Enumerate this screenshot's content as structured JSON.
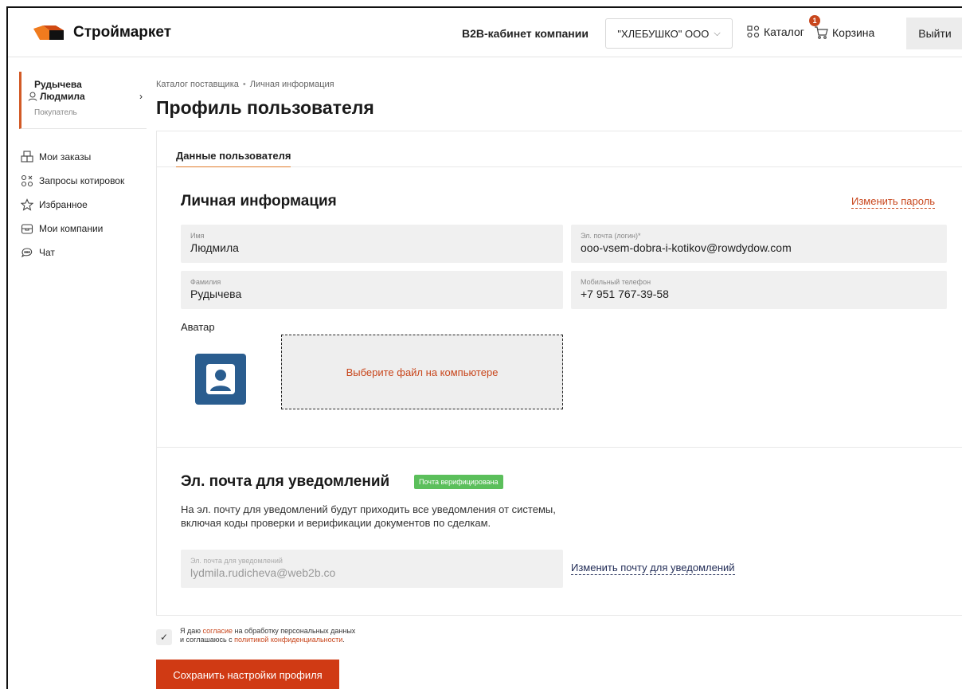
{
  "header": {
    "logo_text": "Строймаркет",
    "b2b_label": "B2B-кабинет компании",
    "company_select": "\"ХЛЕБУШКО\" ООО",
    "catalog_label": "Каталог",
    "cart_label": "Корзина",
    "cart_count": "1",
    "logout_label": "Выйти"
  },
  "sidebar": {
    "user_first_name_line": "Рудычева",
    "user_second_line": "Людмила",
    "user_role": "Покупатель",
    "items": [
      {
        "label": "Мои заказы",
        "icon": "boxes-icon"
      },
      {
        "label": "Запросы котировок",
        "icon": "quotes-icon"
      },
      {
        "label": "Избранное",
        "icon": "star-icon"
      },
      {
        "label": "Мои компании",
        "icon": "company-icon"
      },
      {
        "label": "Чат",
        "icon": "chat-icon"
      }
    ]
  },
  "breadcrumb": {
    "parent": "Каталог поставщика",
    "separator": "•",
    "current": "Личная информация"
  },
  "page_title": "Профиль пользователя",
  "tab_label": "Данные пользователя",
  "personal": {
    "title": "Личная информация",
    "change_password": "Изменить пароль",
    "first_name": {
      "label": "Имя",
      "value": "Людмила"
    },
    "email": {
      "label": "Эл. почта (логин)*",
      "value": "ooo-vsem-dobra-i-kotikov@rowdydow.com"
    },
    "last_name": {
      "label": "Фамилия",
      "value": "Рудычева"
    },
    "phone": {
      "label": "Мобильный телефон",
      "value": "+7 951 767-39-58"
    },
    "avatar_label": "Аватар",
    "dropzone_label": "Выберите файл на компьютере"
  },
  "notifications": {
    "title": "Эл. почта для уведомлений",
    "badge": "Почта верифицирована",
    "description_line1": "На эл. почту для уведомлений будут приходить все уведомления от системы,",
    "description_line2": "включая коды проверки и верификации документов по сделкам.",
    "email_label": "Эл. почта для уведомлений",
    "email_value": "lydmila.rudicheva@web2b.co",
    "change_link": "Изменить почту для уведомлений"
  },
  "consent": {
    "part1": "Я даю ",
    "link1": "согласие",
    "part2": " на обработку персональных данных",
    "part3": "и соглашаюсь с ",
    "link2": "политикой конфиденциальности",
    "part4": "."
  },
  "save_button": "Сохранить настройки профиля",
  "colors": {
    "accent": "#d03a14",
    "link": "#c8461c",
    "verified": "#5bbf5b",
    "avatar": "#2a5d8f"
  }
}
